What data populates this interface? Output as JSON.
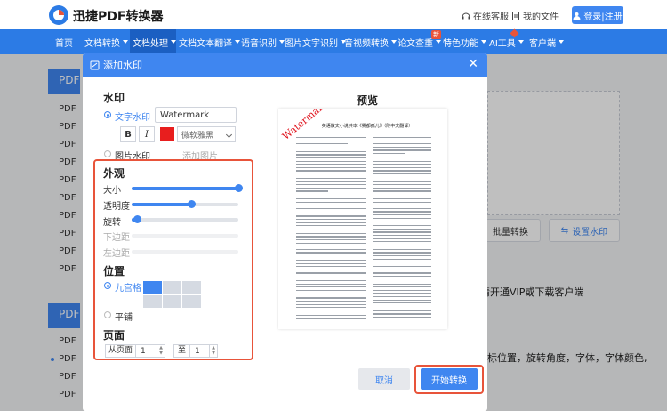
{
  "header": {
    "brand": "迅捷PDF转换器",
    "service_label": "在线客服",
    "files_label": "我的文件",
    "login_label": "登录|注册"
  },
  "nav": {
    "items": [
      {
        "label": "首页"
      },
      {
        "label": "文档转换"
      },
      {
        "label": "文档处理"
      },
      {
        "label": "文档文本翻译"
      },
      {
        "label": "语音识别"
      },
      {
        "label": "图片文字识别"
      },
      {
        "label": "音视频转换"
      },
      {
        "label": "论文查重"
      },
      {
        "label": "特色功能"
      },
      {
        "label": "AI工具"
      },
      {
        "label": "客户端"
      }
    ],
    "new_badge": "新"
  },
  "background": {
    "sidebar_head_1": "PDF",
    "sidebar_head_2": "PDF",
    "sidebar_items": [
      "PDF",
      "PDF",
      "PDF",
      "PDF",
      "PDF",
      "PDF",
      "PDF",
      "PDF",
      "PDF",
      "PDF"
    ],
    "sidebar_items_2": [
      "PDF",
      "PDF",
      "PDF",
      "PDF"
    ],
    "batch_button": "批量转换",
    "set_watermark_button": "设置水印",
    "vip_text": "请开通VIP或下载客户端",
    "hint_text": "标位置，旋转角度，字体，字体颜色,"
  },
  "dialog": {
    "title": "添加水印",
    "watermark_section": "水印",
    "text_watermark_label": "文字水印",
    "text_watermark_value": "Watermark",
    "bold_label": "B",
    "italic_label": "I",
    "font_value": "微软雅黑",
    "image_watermark_label": "图片水印",
    "add_image_label": "添加图片",
    "appearance_section": "外观",
    "size_label": "大小",
    "opacity_label": "透明度",
    "rotate_label": "旋转",
    "bottom_margin_label": "下边距",
    "left_margin_label": "左边距",
    "position_section": "位置",
    "nine_grid_label": "九宫格",
    "tile_label": "平铺",
    "page_section": "页面",
    "from_page_label": "从页面",
    "from_page_value": "1",
    "to_label": "至",
    "to_page_value": "1",
    "preview_title": "预览",
    "cancel_button": "取消",
    "start_button": "开始转换"
  },
  "sliders": {
    "size": 1.0,
    "opacity": 0.56,
    "rotate": 0.05
  },
  "preview": {
    "doc_title": "英语散文小说共本《雾都孤儿》（附中文翻译）",
    "watermark_text": "Watermark"
  },
  "colors": {
    "accent": "#3f86f0",
    "nav": "#2c7be5",
    "highlight": "#e8543a",
    "watermark_color": "#e81e1e"
  }
}
